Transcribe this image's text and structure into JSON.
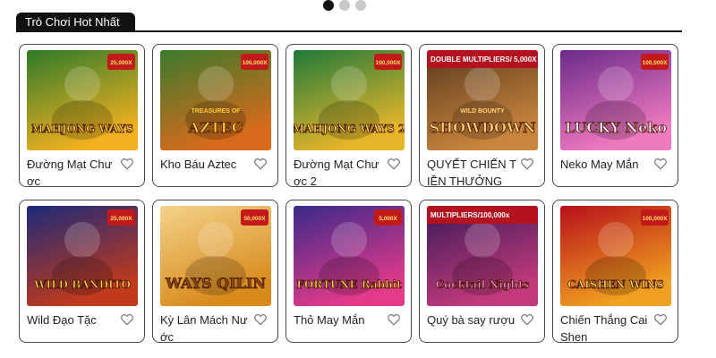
{
  "carousel": {
    "dots": 3,
    "active": 0
  },
  "section": {
    "title": "Trò Chơi Hot Nhất"
  },
  "games": [
    {
      "name": "Đường Mạt Chược",
      "art": "MAHJONG WAYS",
      "art_sub": "",
      "badge": "25,000X",
      "banner": "",
      "bg1": "#2e7a2a",
      "bg2": "#f0b020",
      "text": "#ffd94a"
    },
    {
      "name": "Kho Báu Aztec",
      "art": "AZTEC",
      "art_sub": "TREASURES OF",
      "badge": "100,000X",
      "banner": "",
      "bg1": "#3b7a2c",
      "bg2": "#d96a1c",
      "text": "#ffcc33"
    },
    {
      "name": "Đường Mạt Chược 2",
      "art": "MAHJONG WAYS 2",
      "art_sub": "",
      "badge": "100,000X",
      "banner": "",
      "bg1": "#1f7a3a",
      "bg2": "#e7b52a",
      "text": "#ffe066"
    },
    {
      "name": "QUYẾT CHIẾN TIỀN THƯỞNG",
      "art": "SHOWDOWN",
      "art_sub": "WILD BOUNTY",
      "badge": "",
      "banner": "DOUBLE MULTIPLIERS/ 5,000X",
      "bg1": "#5a3a1f",
      "bg2": "#c9853d",
      "text": "#ffd27a"
    },
    {
      "name": "Neko May Mắn",
      "art": "LUCKY Neko",
      "art_sub": "",
      "badge": "100,000X",
      "banner": "",
      "bg1": "#6a2a8a",
      "bg2": "#f07ac0",
      "text": "#ffe8ff"
    },
    {
      "name": "Wild Đạo Tặc",
      "art": "WILD BANDITO",
      "art_sub": "",
      "badge": "25,000X",
      "banner": "",
      "bg1": "#1c2a7a",
      "bg2": "#c23a1c",
      "text": "#ffd84a"
    },
    {
      "name": "Kỳ Lân Mách Nước",
      "art": "WAYS QILIN",
      "art_sub": "",
      "badge": "50,000X",
      "banner": "",
      "bg1": "#f3d28a",
      "bg2": "#d88a1c",
      "text": "#8a4a0a"
    },
    {
      "name": "Thỏ May Mắn",
      "art": "FORTUNE Rabbit",
      "art_sub": "",
      "badge": "5,000X",
      "banner": "",
      "bg1": "#3a2a8a",
      "bg2": "#e33a8a",
      "text": "#ffd94a"
    },
    {
      "name": "Quý bà say rượu",
      "art": "Cocktail Nights",
      "art_sub": "",
      "badge": "",
      "banner": "MULTIPLIERS/100,000x",
      "bg1": "#3a1a5a",
      "bg2": "#c23a7a",
      "text": "#ff8ad8"
    },
    {
      "name": "Chiến Thắng Cai Shen",
      "art": "CAISHEN WINS",
      "art_sub": "",
      "badge": "100,000X",
      "banner": "",
      "bg1": "#b8101a",
      "bg2": "#f0a020",
      "text": "#ffe066"
    }
  ]
}
